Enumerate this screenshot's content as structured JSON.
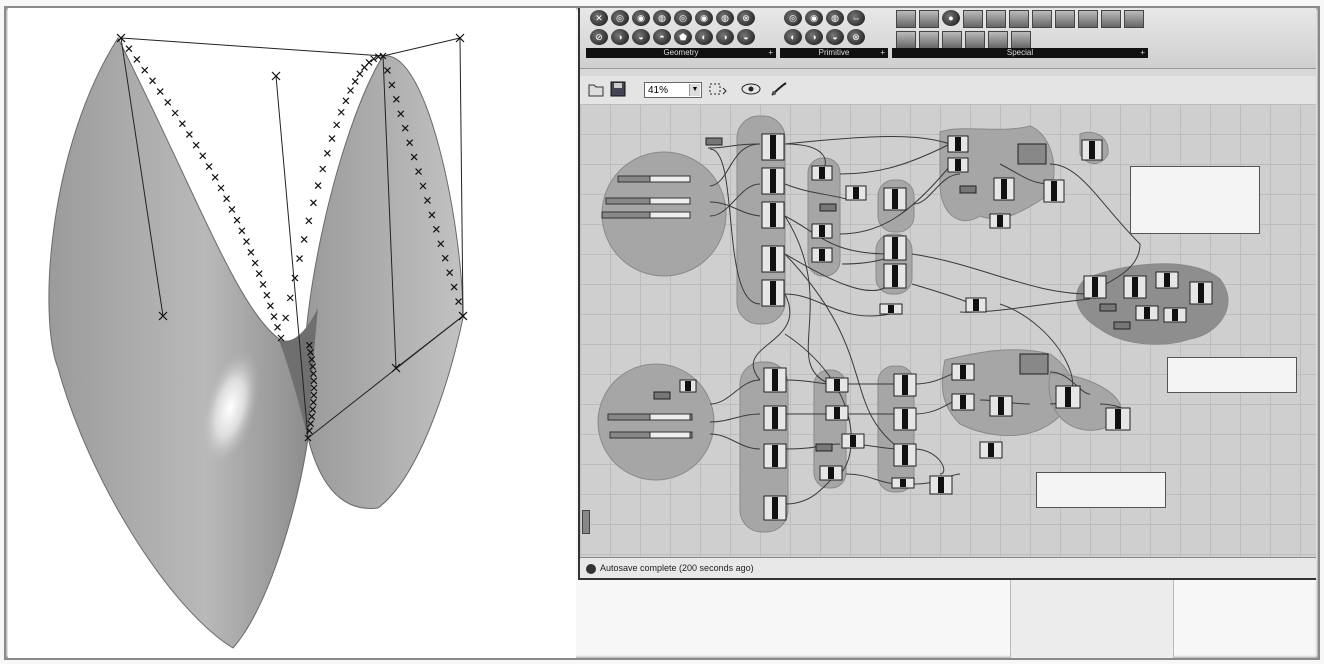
{
  "ribbon": {
    "groups": [
      {
        "label": "Geometry"
      },
      {
        "label": "Primitive"
      },
      {
        "label": "Special"
      }
    ]
  },
  "toolbar": {
    "zoom_value": "41%"
  },
  "status": {
    "message": "Autosave complete (200 seconds ago)"
  },
  "colors": {
    "canvas": "#cfcfcf",
    "group_fill": "#a6a6a6",
    "surface": "#b4b4b4"
  }
}
